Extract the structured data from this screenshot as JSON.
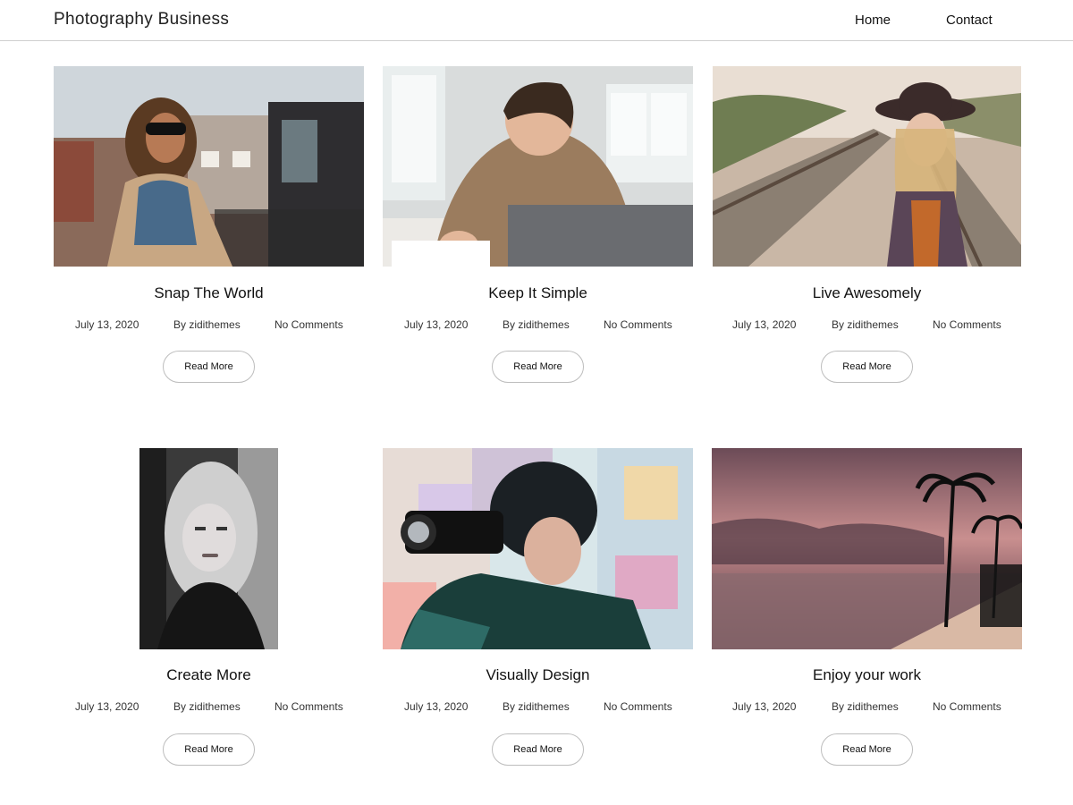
{
  "header": {
    "site_title": "Photography Business",
    "nav": {
      "home": "Home",
      "contact": "Contact"
    }
  },
  "posts": [
    {
      "title": "Snap The World",
      "date": "July 13, 2020",
      "author": "By zidithemes",
      "comments": "No Comments",
      "button": "Read More",
      "image": "woman-sunglasses-rooftop-photo"
    },
    {
      "title": "Keep It Simple",
      "date": "July 13, 2020",
      "author": "By zidithemes",
      "comments": "No Comments",
      "button": "Read More",
      "image": "man-writing-laptop-photo"
    },
    {
      "title": "Live Awesomely",
      "date": "July 13, 2020",
      "author": "By zidithemes",
      "comments": "No Comments",
      "button": "Read More",
      "image": "woman-hat-railway-photo"
    },
    {
      "title": "Create More",
      "date": "July 13, 2020",
      "author": "By zidithemes",
      "comments": "No Comments",
      "button": "Read More",
      "image": "bw-portrait-woman-photo"
    },
    {
      "title": "Visually Design",
      "date": "July 13, 2020",
      "author": "By zidithemes",
      "comments": "No Comments",
      "button": "Read More",
      "image": "photographer-camera-photo"
    },
    {
      "title": "Enjoy your work",
      "date": "July 13, 2020",
      "author": "By zidithemes",
      "comments": "No Comments",
      "button": "Read More",
      "image": "beach-sunset-palms-photo"
    }
  ]
}
